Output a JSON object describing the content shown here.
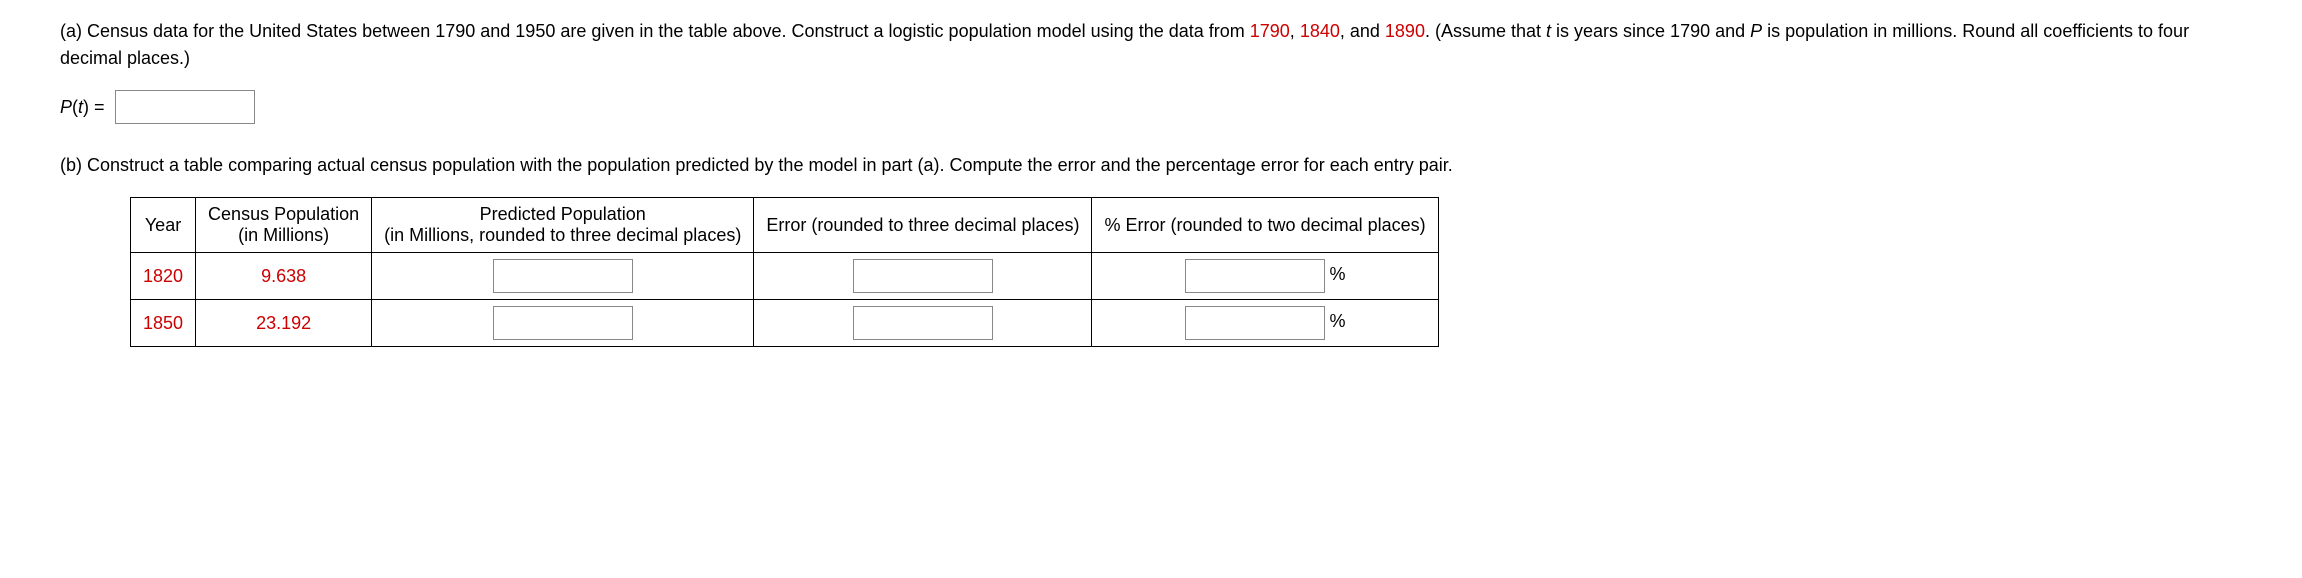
{
  "partA": {
    "text1": "(a) Census data for the United States between 1790 and 1950 are given in the table above. Construct a logistic population model using the data from ",
    "year1": "1790",
    "comma1": ", ",
    "year2": "1840",
    "comma2": ", and ",
    "year3": "1890",
    "text2": ". (Assume that ",
    "var_t": "t",
    "text3": " is years since 1790 and ",
    "var_p": "P",
    "text4": " is population in millions. Round all coefficients to four decimal places.)",
    "formula_lhs1": "P",
    "formula_lhs2": "(",
    "formula_lhs3": "t",
    "formula_lhs4": ") ="
  },
  "partB": {
    "text": "(b) Construct a table comparing actual census population with the population predicted by the model in part (a). Compute the error and the percentage error for each entry pair."
  },
  "table": {
    "headers": {
      "year": "Year",
      "census": "Census Population\n(in Millions)",
      "predicted": "Predicted Population\n(in Millions, rounded to three decimal places)",
      "error": "Error (rounded to three decimal places)",
      "pct_error": "% Error (rounded to two decimal places)"
    },
    "rows": [
      {
        "year": "1820",
        "census": "9.638"
      },
      {
        "year": "1850",
        "census": "23.192"
      }
    ],
    "pct_sign": "%"
  }
}
